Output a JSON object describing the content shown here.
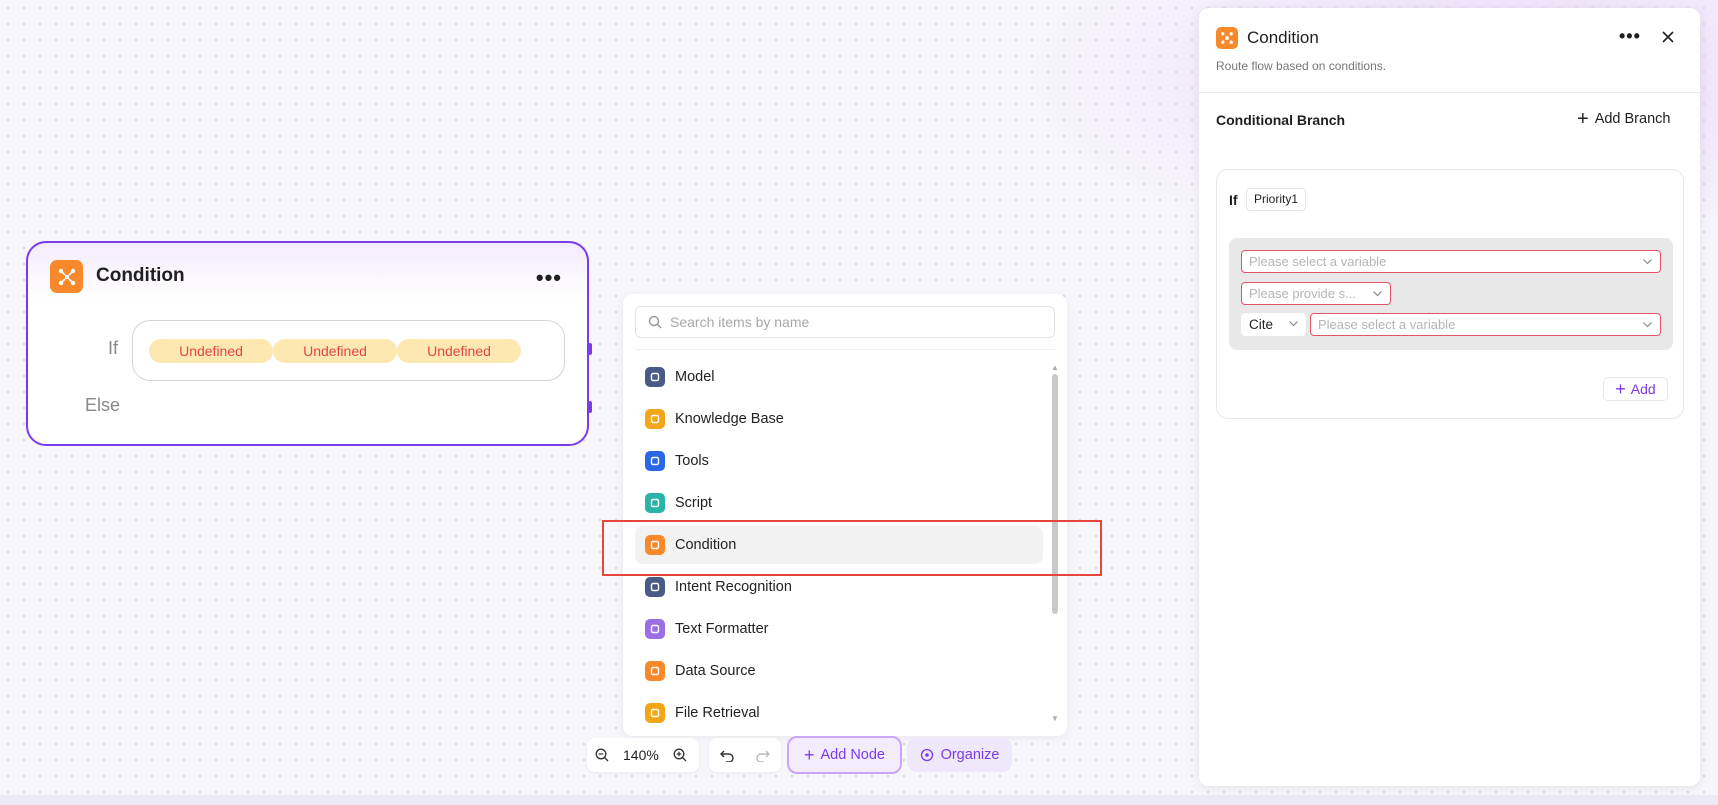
{
  "canvas_node": {
    "title": "Condition",
    "more_label": "•••",
    "if_label": "If",
    "else_label": "Else",
    "conditions": [
      "Undefined",
      "Undefined",
      "Undefined"
    ]
  },
  "picker": {
    "search_placeholder": "Search items by name",
    "items": [
      {
        "label": "Model",
        "icon": "model-icon",
        "color": "#4a5a86"
      },
      {
        "label": "Knowledge Base",
        "icon": "knowledge-base-icon",
        "color": "#f2a617"
      },
      {
        "label": "Tools",
        "icon": "tools-icon",
        "color": "#2a66e8"
      },
      {
        "label": "Script",
        "icon": "script-icon",
        "color": "#2bb3a8"
      },
      {
        "label": "Condition",
        "icon": "condition-icon",
        "color": "#f7892a"
      },
      {
        "label": "Intent Recognition",
        "icon": "intent-recognition-icon",
        "color": "#4a5a86"
      },
      {
        "label": "Text Formatter",
        "icon": "text-formatter-icon",
        "color": "#9b6ee6"
      },
      {
        "label": "Data Source",
        "icon": "data-source-icon",
        "color": "#f7892a"
      },
      {
        "label": "File Retrieval",
        "icon": "file-retrieval-icon",
        "color": "#f2a617"
      }
    ],
    "active_item": "Condition"
  },
  "toolbar": {
    "zoom": "140%",
    "add_node_label": "Add Node",
    "organize_label": "Organize"
  },
  "panel": {
    "title": "Condition",
    "subtitle": "Route flow based on conditions.",
    "more_label": "•••",
    "section_title": "Conditional Branch",
    "add_branch_label": "Add Branch",
    "branch": {
      "if_label": "If",
      "priority": "Priority1",
      "variable_placeholder": "Please select a variable",
      "operator_placeholder": "Please provide s...",
      "cite_label": "Cite",
      "value_placeholder": "Please select a variable",
      "add_label": "Add"
    }
  },
  "colors": {
    "accent": "#7c3aed",
    "condition_orange": "#f7892a",
    "error_red": "#e5556a",
    "highlight_red": "#e5453a"
  }
}
